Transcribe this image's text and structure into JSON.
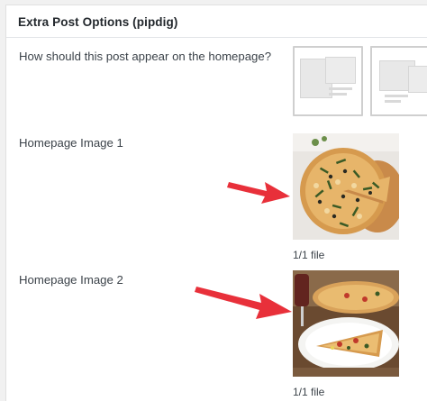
{
  "metabox": {
    "title": "Extra Post Options (pipdig)"
  },
  "fields": {
    "layout_label": "How should this post appear on the homepage?",
    "image1_label": "Homepage Image 1",
    "image2_label": "Homepage Image 2"
  },
  "images": {
    "image1_count": "1/1 file",
    "image2_count": "1/1 file"
  },
  "colors": {
    "arrow": "#e8303a",
    "layout_border": "#cfcfcf"
  },
  "icons": [
    "arrow-pointer-red"
  ]
}
